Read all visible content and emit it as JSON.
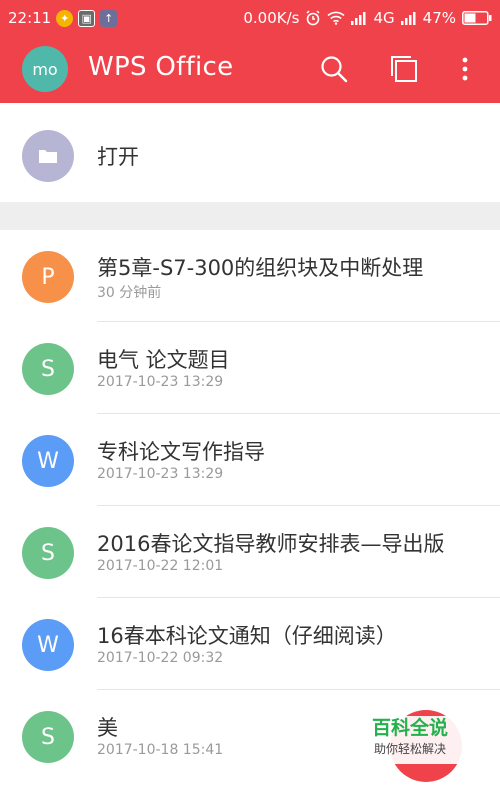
{
  "status_bar": {
    "time": "22:11",
    "speed": "0.00K/s",
    "network": "4G",
    "battery": "47%"
  },
  "app_bar": {
    "avatar_text": "mo",
    "title": "WPS Office",
    "icons": [
      "search-icon",
      "multi-window-icon",
      "more-vert-icon"
    ]
  },
  "open": {
    "label": "打开",
    "icon": "folder-icon"
  },
  "recent_files": [
    {
      "type_letter": "P",
      "color": "#f79049",
      "name": "第5章-S7-300的组织块及中断处理",
      "time": "30 分钟前"
    },
    {
      "type_letter": "S",
      "color": "#6dc48a",
      "name": "电气 论文题目",
      "time": "2017-10-23   13:29"
    },
    {
      "type_letter": "W",
      "color": "#5b9cf6",
      "name": "专科论文写作指导",
      "time": "2017-10-23   13:29"
    },
    {
      "type_letter": "S",
      "color": "#6dc48a",
      "name": "2016春论文指导教师安排表—导出版",
      "time": "2017-10-22   12:01"
    },
    {
      "type_letter": "W",
      "color": "#5b9cf6",
      "name": "16春本科论文通知（仔细阅读）",
      "time": "2017-10-22   09:32"
    },
    {
      "type_letter": "S",
      "color": "#6dc48a",
      "name": "美",
      "time": "2017-10-18   15:41"
    }
  ],
  "watermark": {
    "title": "百科全说",
    "subtitle": "助你轻松解决"
  },
  "colors": {
    "accent": "#f0424a",
    "avatar": "#4fb8ab",
    "open_icon": "#b6b5d3"
  }
}
